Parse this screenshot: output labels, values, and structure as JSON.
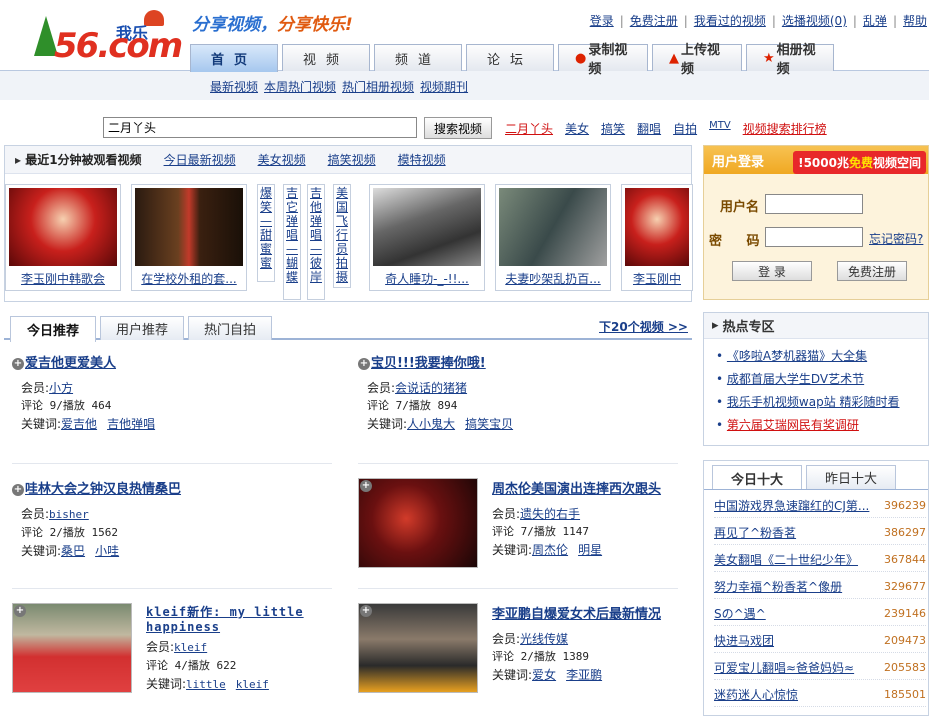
{
  "header": {
    "logo_brand": "我乐",
    "logo_num": "56.com",
    "slogan_a": "分享视频，",
    "slogan_b": "分享快乐!",
    "top_links": [
      "登录",
      "免费注册",
      "我看过的视频",
      "选播视频(0)",
      "乱弹",
      "帮助"
    ]
  },
  "nav": {
    "tabs": [
      "首页",
      "视频",
      "频道",
      "论坛"
    ],
    "special_tabs": [
      {
        "icon": "record-dot-icon",
        "label": "录制视频"
      },
      {
        "icon": "upload-triangle-icon",
        "label": "上传视频"
      },
      {
        "icon": "star-icon",
        "label": "相册视频"
      }
    ],
    "sub_links": [
      "最新视频",
      "本周热门视频",
      "热门相册视频",
      "视频期刊"
    ]
  },
  "search": {
    "value": "二月丫头",
    "button": "搜索视频",
    "hot_words": [
      "二月丫头",
      "美女",
      "搞笑",
      "翻唱",
      "自拍",
      "MTV",
      "视频搜索排行榜"
    ]
  },
  "recent": {
    "title": "最近1分钟被观看视频",
    "tabs": [
      "今日最新视频",
      "美女视频",
      "搞笑视频",
      "模特视频"
    ],
    "thumbs": [
      {
        "caption": "李玉刚中韩歌会"
      },
      {
        "caption": "在学校外租的套..."
      },
      {
        "caption": "奇人睡功-_-!!..."
      },
      {
        "caption": "夫妻吵架乱扔百..."
      },
      {
        "caption": "李玉刚中"
      }
    ],
    "vertical_titles": [
      "爆笑—甜蜜蜜",
      "吉它弹唱—蝴蝶",
      "吉他弹唱—彼岸",
      "美国飞行员拍摄"
    ]
  },
  "login": {
    "title": "用户登录",
    "badge_a": "5000兆",
    "badge_b": "免费",
    "badge_c": "视频空间",
    "username_label": "用户名",
    "password_label": "密 码",
    "forgot": "忘记密码?",
    "login_btn": "登 录",
    "register_btn": "免费注册"
  },
  "main_tabs": [
    "今日推荐",
    "用户推荐",
    "热门自拍"
  ],
  "next20": "下20个视频 >>",
  "meta_labels": {
    "member": "会员:",
    "keywords": "关键词:"
  },
  "videos": [
    {
      "title": "爱吉他更爱美人",
      "member": "小方",
      "stats": "评论 9/播放 464",
      "keywords": [
        "爱吉他",
        "吉他弹唱"
      ]
    },
    {
      "title": "宝贝!!!我要捧你哦!",
      "member": "会说话的猪猪",
      "stats": "评论 7/播放 894",
      "keywords": [
        "人小鬼大",
        "搞笑宝贝"
      ]
    },
    {
      "title": "哇林大会之钟汉良热情桑巴",
      "member": "bisher",
      "stats": "评论 2/播放 1562",
      "keywords": [
        "桑巴",
        "小哇"
      ]
    },
    {
      "title": "周杰伦美国演出连摔西次跟头",
      "member": "遗失的右手",
      "stats": "评论 7/播放 1147",
      "keywords": [
        "周杰伦",
        "明星"
      ]
    },
    {
      "title": "kleif新作: my little happiness",
      "member": "kleif",
      "stats": "评论 4/播放 622",
      "keywords": [
        "little",
        "kleif"
      ]
    },
    {
      "title": "李亚鹏自爆爱女术后最新情况",
      "member": "光线传媒",
      "stats": "评论 2/播放 1389",
      "keywords": [
        "爱女",
        "李亚鹏"
      ]
    }
  ],
  "hotzone": {
    "title": "热点专区",
    "items": [
      "《哆啦A梦机器猫》大全集",
      "成都首届大学生DV艺术节",
      "我乐手机视频wap站 精彩随时看",
      "第六届艾瑞网民有奖调研"
    ]
  },
  "top10": {
    "tabs": [
      "今日十大",
      "昨日十大"
    ],
    "rows": [
      {
        "title": "中国游戏界急速蹿红的CJ第...",
        "count": "396239"
      },
      {
        "title": "再见了^粉香茗",
        "count": "386297"
      },
      {
        "title": "美女翻唱《二十世纪少年》",
        "count": "367844"
      },
      {
        "title": "努力幸福^粉香茗^像册",
        "count": "329677"
      },
      {
        "title": "Sの^遇^",
        "count": "239146"
      },
      {
        "title": "快进马戏团",
        "count": "209473"
      },
      {
        "title": "可爱宝儿翻唱≈爸爸妈妈≈",
        "count": "205583"
      },
      {
        "title": "迷药迷人心惊惊",
        "count": "185501"
      }
    ]
  }
}
